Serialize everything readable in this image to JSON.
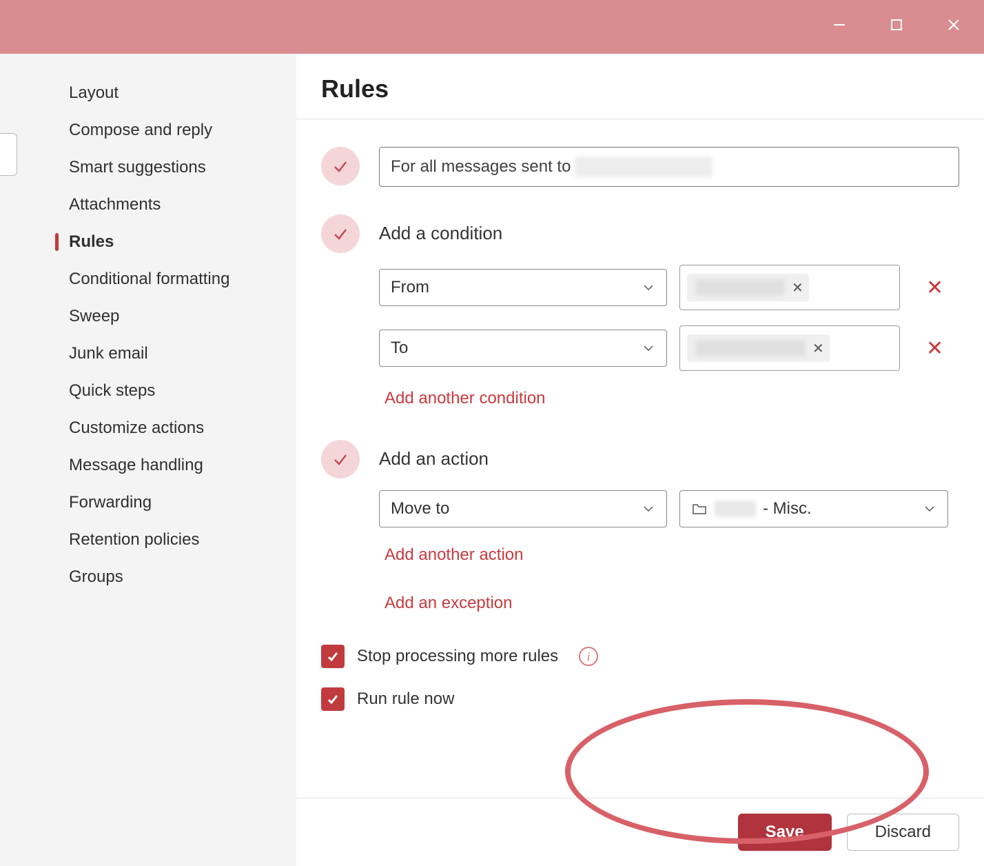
{
  "sidebar": {
    "items": [
      {
        "label": "Layout"
      },
      {
        "label": "Compose and reply"
      },
      {
        "label": "Smart suggestions"
      },
      {
        "label": "Attachments"
      },
      {
        "label": "Rules"
      },
      {
        "label": "Conditional formatting"
      },
      {
        "label": "Sweep"
      },
      {
        "label": "Junk email"
      },
      {
        "label": "Quick steps"
      },
      {
        "label": "Customize actions"
      },
      {
        "label": "Message handling"
      },
      {
        "label": "Forwarding"
      },
      {
        "label": "Retention policies"
      },
      {
        "label": "Groups"
      }
    ]
  },
  "main": {
    "title": "Rules",
    "rule_name_prefix": "For all messages sent to",
    "condition_title": "Add a condition",
    "conditions": [
      {
        "field": "From"
      },
      {
        "field": "To"
      }
    ],
    "add_condition_link": "Add another condition",
    "action_title": "Add an action",
    "action_field": "Move to",
    "action_folder_suffix": "- Misc.",
    "add_action_link": "Add another action",
    "add_exception_link": "Add an exception",
    "checkbox1": "Stop processing more rules",
    "checkbox2": "Run rule now"
  },
  "footer": {
    "save": "Save",
    "discard": "Discard"
  }
}
